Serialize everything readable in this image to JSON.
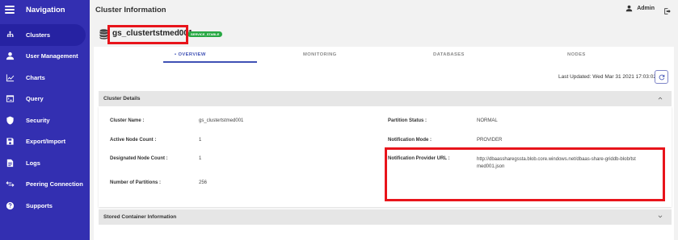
{
  "nav": {
    "title": "Navigation",
    "items": [
      {
        "label": "Clusters",
        "icon": "cluster-icon"
      },
      {
        "label": "User Management",
        "icon": "user-icon"
      },
      {
        "label": "Charts",
        "icon": "chart-icon"
      },
      {
        "label": "Query",
        "icon": "terminal-icon"
      },
      {
        "label": "Security",
        "icon": "shield-icon"
      },
      {
        "label": "Export/Import",
        "icon": "save-icon"
      },
      {
        "label": "Logs",
        "icon": "document-icon"
      },
      {
        "label": "Peering Connection",
        "icon": "swap-icon"
      },
      {
        "label": "Supports",
        "icon": "help-icon"
      }
    ],
    "active_index": 0
  },
  "header": {
    "title": "Cluster Information",
    "user": "Admin"
  },
  "cluster": {
    "name": "gs_clustertstmed001",
    "status": "SERVICE_STABLE"
  },
  "tabs": [
    {
      "label": "• OVERVIEW",
      "active": true
    },
    {
      "label": "MONITORING",
      "active": false
    },
    {
      "label": "DATABASES",
      "active": false
    },
    {
      "label": "NODES",
      "active": false
    }
  ],
  "last_updated": "Last Updated: Wed Mar 31 2021 17:03:02",
  "details": {
    "title": "Cluster Details",
    "cluster_name_label": "Cluster Name :",
    "cluster_name_value": "gs_clustertstmed001",
    "active_node_label": "Active Node Count :",
    "active_node_value": "1",
    "designated_node_label": "Designated Node Count :",
    "designated_node_value": "1",
    "partitions_label": "Number of Partitions :",
    "partitions_value": "256",
    "partition_status_label": "Partition Status :",
    "partition_status_value": "NORMAL",
    "notification_mode_label": "Notification Mode :",
    "notification_mode_value": "PROVIDER",
    "provider_url_label": "Notification Provider URL :",
    "provider_url_value": "http://dbaassharegssta.blob.core.windows.net/dbaas-share-griddb-blob/tstmed001.json"
  },
  "stored": {
    "title": "Stored Container Information"
  },
  "colors": {
    "sidebar": "#332fb1",
    "accent": "#3f51b5",
    "badge": "#27a843",
    "highlight": "#e8141b"
  }
}
